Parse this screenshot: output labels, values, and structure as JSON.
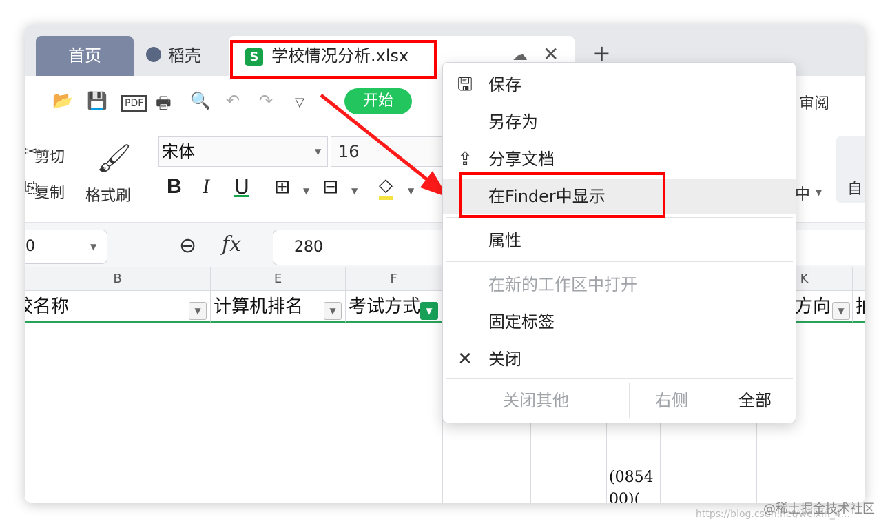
{
  "tabs": {
    "home_label": "首页",
    "daoke_label": "稻壳",
    "file_label": "学校情况分析.xlsx",
    "new_tab": "+"
  },
  "toolbar": {
    "start_label": "开始",
    "review_label": "审阅",
    "cut_label": "剪切",
    "copy_label": "复制",
    "format_painter_label": "格式刷",
    "font_name": "宋体",
    "font_size": "16",
    "center_label": "中",
    "auto_label": "自"
  },
  "formula": {
    "cell_ref": "0",
    "value": "280"
  },
  "grid": {
    "columns": [
      "B",
      "E",
      "F",
      "K"
    ],
    "headers": [
      "校名称",
      "计算机排名",
      "考试方式",
      "方向",
      "拍"
    ],
    "cell_fragment_1": "(0854",
    "cell_fragment_2": "00)("
  },
  "context_menu": {
    "save": "保存",
    "save_as": "另存为",
    "share": "分享文档",
    "show_in_finder": "在Finder中显示",
    "properties": "属性",
    "open_in_new_workspace": "在新的工作区中打开",
    "pin_tab": "固定标签",
    "close": "关闭",
    "close_others": "关闭其他",
    "right_side": "右侧",
    "all": "全部"
  },
  "watermark": {
    "site": "@稀土掘金技术社区",
    "url": "https://blog.csdn.net/weixin_4..."
  },
  "colors": {
    "highlight": "#ff0000",
    "accent_green": "#22c55e",
    "home_tab": "#7b87a3"
  }
}
